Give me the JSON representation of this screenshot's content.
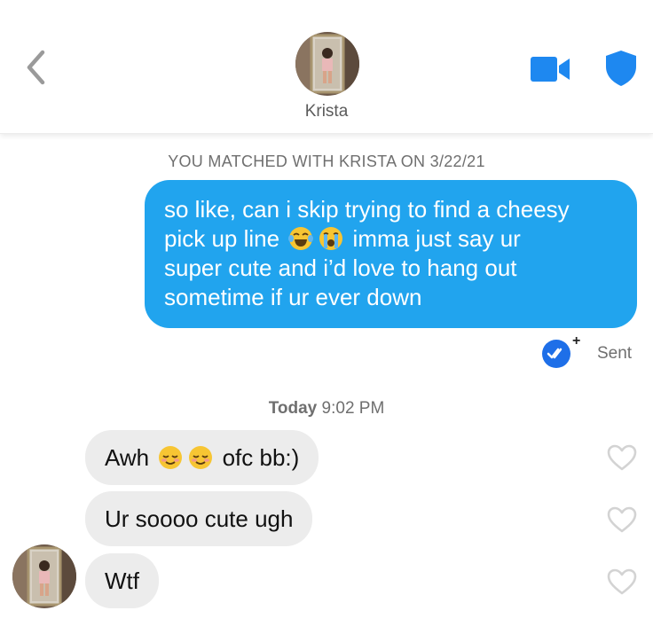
{
  "header": {
    "contact_name": "Krista",
    "icons": {
      "back": "chevron-left-icon",
      "video": "video-camera-icon",
      "safety": "shield-icon"
    },
    "accent_color": "#1e88f0"
  },
  "match_banner": "YOU MATCHED WITH KRISTA ON 3/22/21",
  "outgoing": {
    "lines": [
      {
        "text_a": "so like, can i skip trying to find a cheesy"
      },
      {
        "text_a": "pick up line",
        "emoji_1": "laughing-tears-emoji",
        "emoji_2": "crying-emoji",
        "text_b": "imma just say ur"
      },
      {
        "text_a": "super cute and i’d love to hang out"
      },
      {
        "text_a": "sometime if ur ever down"
      }
    ],
    "bubble_color": "#21a4ee",
    "status": "Sent",
    "status_plus": "+"
  },
  "divider": {
    "day": "Today",
    "time": "9:02 PM"
  },
  "incoming": [
    {
      "text_a": "Awh",
      "emoji": [
        "relieved-emoji",
        "relieved-emoji"
      ],
      "text_b": "ofc bb:)"
    },
    {
      "text_a": "Ur soooo cute ugh"
    },
    {
      "text_a": "Wtf"
    }
  ],
  "incoming_bubble_color": "#ececec"
}
